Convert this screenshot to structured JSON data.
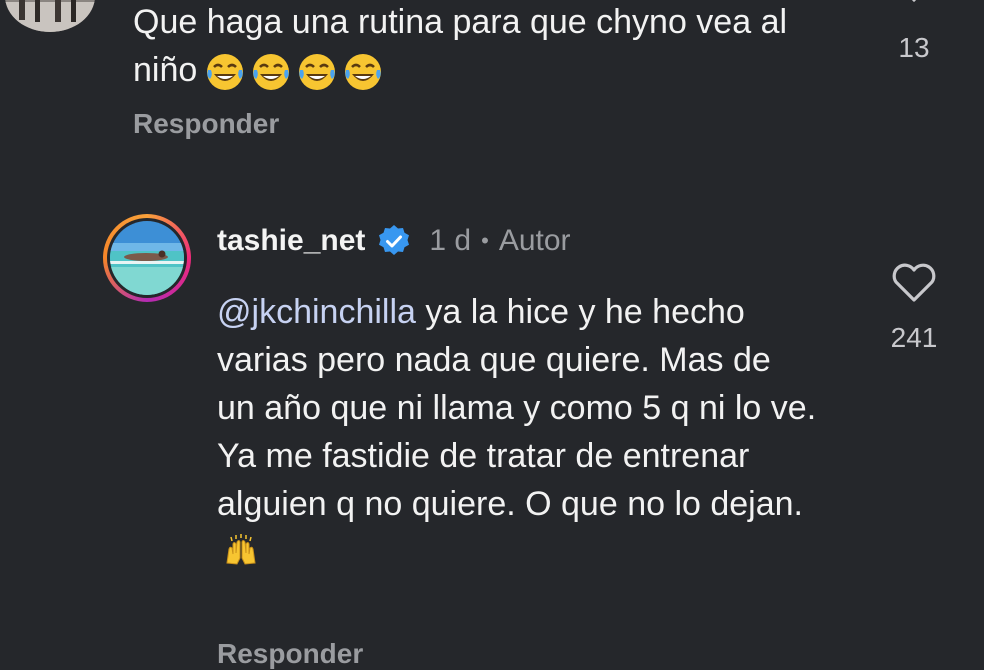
{
  "comment1": {
    "text": "Que haga una rutina para que chyno vea al niño",
    "emoji_icons": [
      "joy-emoji",
      "joy-emoji",
      "joy-emoji",
      "joy-emoji"
    ],
    "like_count": "13",
    "reply_label": "Responder"
  },
  "comment2": {
    "username": "tashie_net",
    "verified_icon": "verified-badge-icon",
    "time": "1 d",
    "separator": "•",
    "author_label": "Autor",
    "mention": "@jkchinchilla",
    "body": " ya la hice y he hecho varias pero nada que quiere. Mas de un año que ni llama y como 5 q ni lo ve. Ya me fastidie de tratar de entrenar alguien q no quiere. O que no lo dejan.",
    "emoji_icon": "raising-hands-emoji",
    "like_count": "241",
    "reply_label": "Responder"
  },
  "colors": {
    "background": "#25272b",
    "text": "#f2f2f2",
    "muted": "#9a9ca0",
    "mention": "#c7d2f2",
    "verified": "#3897f0"
  }
}
